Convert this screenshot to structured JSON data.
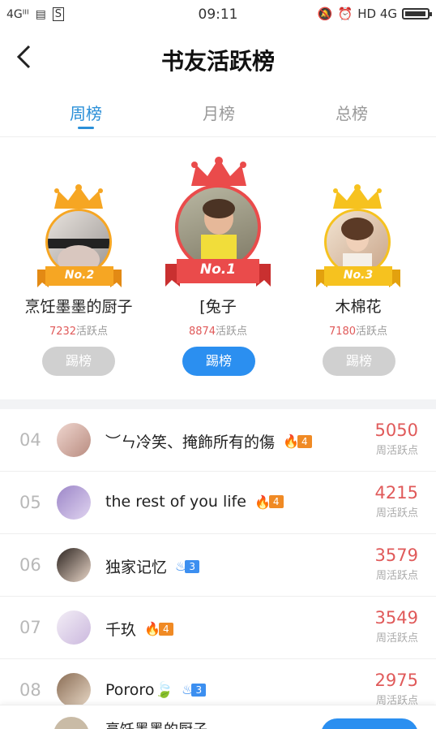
{
  "status_bar": {
    "signal": "4Gᴵᴵᴵ",
    "time": "09:11",
    "right_text": "HD 4G"
  },
  "header": {
    "title": "书友活跃榜",
    "back": "‹"
  },
  "tabs": [
    {
      "label": "周榜",
      "active": true
    },
    {
      "label": "月榜",
      "active": false
    },
    {
      "label": "总榜",
      "active": false
    }
  ],
  "podium": [
    {
      "badge": "No.2",
      "name": "烹饪墨墨的厨子",
      "points": "7232",
      "points_unit": "活跃点",
      "button": "踢榜"
    },
    {
      "badge": "No.1",
      "name": "[兔子",
      "points": "8874",
      "points_unit": "活跃点",
      "button": "踢榜"
    },
    {
      "badge": "No.3",
      "name": "木棉花",
      "points": "7180",
      "points_unit": "活跃点",
      "button": "踢榜"
    }
  ],
  "list": [
    {
      "rank": "04",
      "name": "︶ㄣ冷笑、掩飾所有的傷",
      "level": "4",
      "level_color": "orange",
      "score": "5050",
      "unit": "周活跃点"
    },
    {
      "rank": "05",
      "name": "the rest of you life",
      "level": "4",
      "level_color": "orange",
      "score": "4215",
      "unit": "周活跃点"
    },
    {
      "rank": "06",
      "name": "独家记忆",
      "level": "3",
      "level_color": "blue",
      "score": "3579",
      "unit": "周活跃点"
    },
    {
      "rank": "07",
      "name": "千玖",
      "level": "4",
      "level_color": "orange",
      "score": "3549",
      "unit": "周活跃点"
    },
    {
      "rank": "08",
      "name": "Pororo🍃",
      "level": "3",
      "level_color": "blue",
      "score": "2975",
      "unit": "周活跃点"
    }
  ],
  "bottom_bar": {
    "name": "烹饪墨墨的厨子",
    "button": ""
  },
  "colors": {
    "accent": "#2a8fd8",
    "score": "#e05a5a",
    "gold": "#f6a623",
    "red": "#ea4b4b",
    "orange_badge": "#f08a24",
    "blue_badge": "#3c8ff0"
  }
}
